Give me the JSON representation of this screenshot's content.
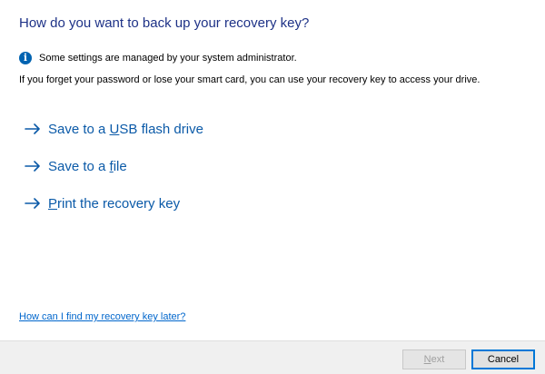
{
  "dialog": {
    "title": "How do you want to back up your recovery key?",
    "info_message": "Some settings are managed by your system administrator.",
    "description": "If you forget your password or lose your smart card, you can use your recovery key to access your drive."
  },
  "options": [
    {
      "pre": "Save to a ",
      "key": "U",
      "post": "SB flash drive"
    },
    {
      "pre": "Save to a ",
      "key": "f",
      "post": "ile"
    },
    {
      "pre": "",
      "key": "P",
      "post": "rint the recovery key"
    }
  ],
  "help_link": "How can I find my recovery key later?",
  "buttons": {
    "next_key": "N",
    "next_rest": "ext",
    "next_enabled": false,
    "cancel": "Cancel"
  },
  "colors": {
    "title": "#1e3287",
    "link": "#0b5aa8",
    "info_icon": "#0063b1",
    "footer": "#f0f0f0"
  },
  "icons": {
    "info": "info-icon",
    "command_arrow": "arrow-right-icon"
  }
}
